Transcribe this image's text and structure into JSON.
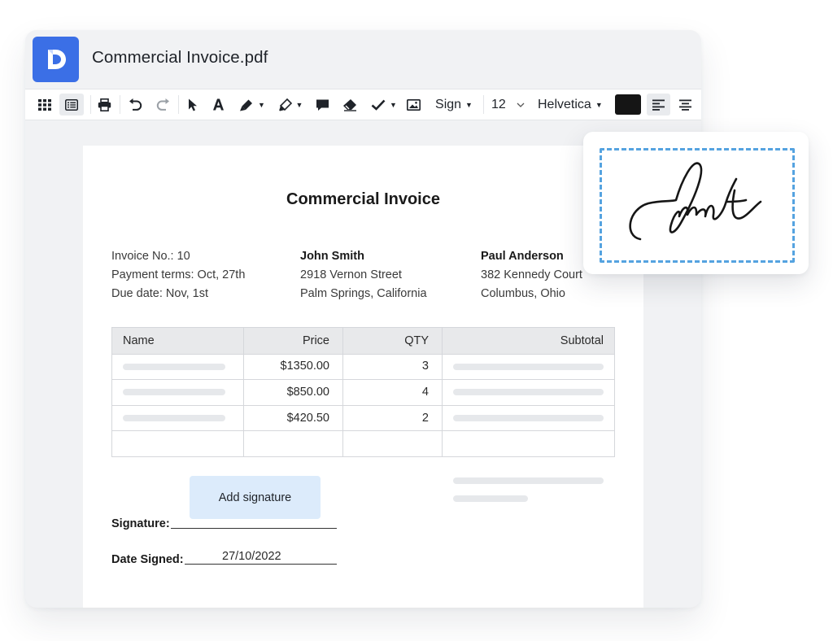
{
  "window": {
    "doc_title": "Commercial Invoice.pdf",
    "accent_color": "#3b6fe6"
  },
  "toolbar": {
    "icons": [
      "grid-icon",
      "list-view-icon",
      "print-icon",
      "undo-icon",
      "redo-icon",
      "select-arrow-icon",
      "text-icon",
      "pen-icon",
      "highlighter-icon",
      "comment-icon",
      "eraser-icon",
      "checkmark-icon",
      "image-icon",
      "align-left-icon",
      "align-center-icon"
    ],
    "sign_label": "Sign",
    "font_size": "12",
    "font_name": "Helvetica",
    "color_swatch": "#151515"
  },
  "invoice": {
    "title": "Commercial Invoice",
    "meta": {
      "invoice_no": "Invoice No.: 10",
      "payment_terms": "Payment terms: Oct, 27th",
      "due_date": "Due date: Nov, 1st"
    },
    "from": {
      "name": "John Smith",
      "street": "2918 Vernon Street",
      "city": "Palm Springs, California"
    },
    "to": {
      "name": "Paul Anderson",
      "street": "382 Kennedy Court",
      "city": "Columbus, Ohio"
    },
    "table": {
      "headers": [
        "Name",
        "Price",
        "QTY",
        "Subtotal"
      ],
      "rows": [
        {
          "price": "$1350.00",
          "qty": "3"
        },
        {
          "price": "$850.00",
          "qty": "4"
        },
        {
          "price": "$420.50",
          "qty": "2"
        }
      ]
    },
    "add_signature_label": "Add signature",
    "signature_label": "Signature:",
    "date_signed_label": "Date Signed:",
    "date_signed_value": "27/10/2022"
  },
  "signature_card": {
    "frame_color": "#55a3e0"
  }
}
